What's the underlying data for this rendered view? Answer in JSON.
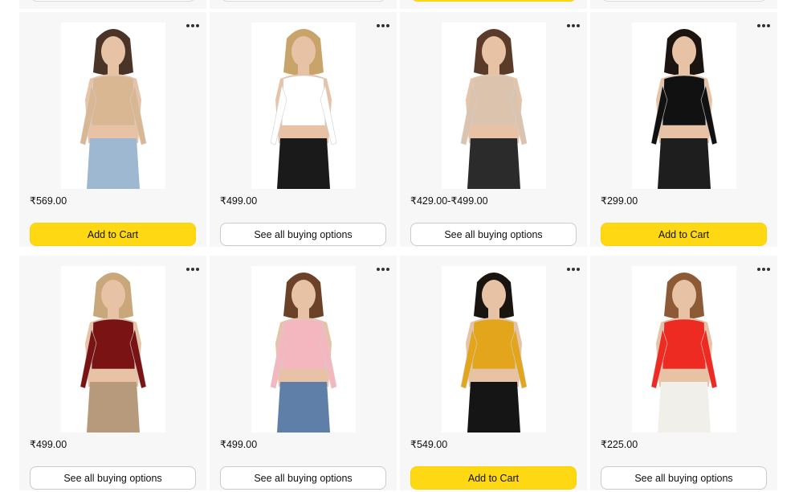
{
  "more_options_icon": "more-options-icon",
  "products": [
    {
      "price": "₹569.00",
      "button_label": "Add to Cart",
      "button_style": "yellow",
      "top_color": "#d8b792",
      "bottom_color": "#9fb8d2",
      "hair_color": "#4a3327"
    },
    {
      "price": "₹499.00",
      "button_label": "See all buying options",
      "button_style": "outline",
      "top_color": "#ffffff",
      "bottom_color": "#1a1a1a",
      "hair_color": "#c9a46a"
    },
    {
      "price": "₹429.00-₹499.00",
      "button_label": "See all buying options",
      "button_style": "outline",
      "top_color": "#dcc3ae",
      "bottom_color": "#2b2b2b",
      "hair_color": "#5a3b2a"
    },
    {
      "price": "₹299.00",
      "button_label": "Add to Cart",
      "button_style": "yellow",
      "top_color": "#111111",
      "bottom_color": "#1e1e1e",
      "hair_color": "#1c1410"
    },
    {
      "price": "₹499.00",
      "button_label": "See all buying options",
      "button_style": "outline",
      "top_color": "#7a1414",
      "bottom_color": "#b79a7c",
      "hair_color": "#c8a77a"
    },
    {
      "price": "₹499.00",
      "button_label": "See all buying options",
      "button_style": "outline",
      "top_color": "#f4b6bf",
      "bottom_color": "#5f7fa8",
      "hair_color": "#6b4228"
    },
    {
      "price": "₹549.00",
      "button_label": "Add to Cart",
      "button_style": "yellow",
      "top_color": "#e3a51c",
      "bottom_color": "#151515",
      "hair_color": "#1a1410"
    },
    {
      "price": "₹225.00",
      "button_label": "See all buying options",
      "button_style": "outline",
      "top_color": "#ee2b22",
      "bottom_color": "#f1efea",
      "hair_color": "#8c5a35"
    }
  ],
  "previous_row_buttons": [
    "outline",
    "outline",
    "yellow",
    "outline"
  ]
}
